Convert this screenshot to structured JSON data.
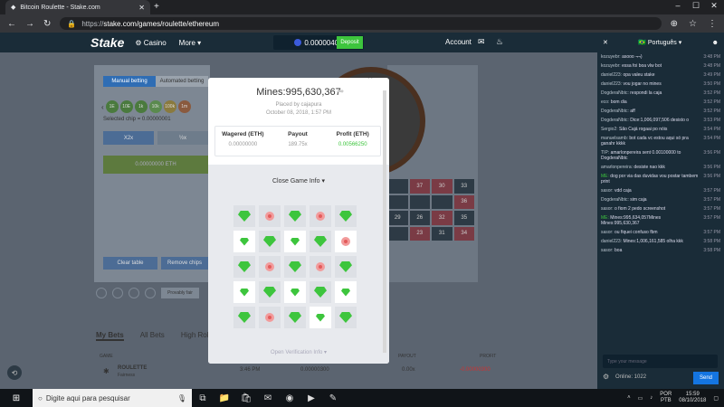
{
  "browser": {
    "tab_title": "Bitcoin Roulette - Stake.com",
    "url_prefix": "https://",
    "url": "stake.com/games/roulette/ethereum"
  },
  "header": {
    "logo": "Stake",
    "casino": "Casino",
    "more": "More",
    "balance": "0.00000400",
    "deposit": "Deposit",
    "account": "Account"
  },
  "game": {
    "manual": "Manual betting",
    "auto": "Automated betting",
    "chips": [
      "1E",
      "10E",
      "1k",
      "10k",
      "100k",
      "1m"
    ],
    "selected_chip": "Selected chip = 0.00000001",
    "x2": "X2x",
    "half": "½x",
    "bet_total": "0.00000000 ETH",
    "clear": "Clear table",
    "remove": "Remove chips",
    "provably": "Provably fair",
    "grid_numbers": [
      "",
      "37",
      "30",
      "33",
      "",
      "",
      "",
      "36",
      "29",
      "26",
      "32",
      "35",
      "",
      "23",
      "31",
      "34",
      "",
      "",
      "",
      ""
    ]
  },
  "bets": {
    "tabs": [
      "My Bets",
      "All Bets",
      "High Rollers"
    ],
    "head": {
      "game": "GAME",
      "payout": "PAYOUT",
      "profit": "PROFIT"
    },
    "row": {
      "name": "ROULETTE",
      "sub": "Fairness",
      "time": "3:46 PM",
      "amount": "0.00000300",
      "payout": "0.00x",
      "profit": "-0.00000300"
    }
  },
  "modal": {
    "title": "Mines:995,630,367",
    "placed_by": "Placed by",
    "user": "cajapura",
    "date": "October 08, 2018, 1:57 PM",
    "stats": [
      {
        "label": "Wagered (ETH)",
        "value": "0.00000000"
      },
      {
        "label": "Payout",
        "value": "189.75x"
      },
      {
        "label": "Profit (ETH)",
        "value": "0.00566250"
      }
    ],
    "close_info": "Close Game Info",
    "open_verification": "Open Verification Info",
    "tiles": [
      "gem",
      "mine",
      "gem",
      "mine",
      "gem",
      "gem-rev",
      "gem",
      "gem-rev",
      "gem",
      "mine-rev",
      "gem",
      "mine",
      "gem",
      "mine",
      "gem",
      "gem-rev",
      "gem",
      "gem-rev",
      "gem",
      "gem-rev",
      "gem",
      "mine",
      "gem",
      "gem-rev",
      "gem"
    ]
  },
  "chat": {
    "language": "Português",
    "messages": [
      {
        "user": "kozuyebr:",
        "text": "asooo ¬¬)",
        "time": "3:48 PM"
      },
      {
        "user": "kozuyebr:",
        "text": "essa foi boa vlw bot",
        "time": "3:48 PM"
      },
      {
        "user": "daniel223:",
        "text": "opa valeu stake",
        "time": "3:49 PM"
      },
      {
        "user": "daniel223:",
        "text": "vou jogar no mines",
        "time": "3:50 PM"
      },
      {
        "user": "DogderaNbtc:",
        "text": "respondi la caja",
        "time": "3:52 PM"
      },
      {
        "user": "eco:",
        "text": "bom dia",
        "time": "3:52 PM"
      },
      {
        "user": "DogderaNbtc:",
        "text": "aff",
        "time": "3:52 PM"
      },
      {
        "user": "DogderaNbtc:",
        "text": "Dice:1,006,097,506 desisto o",
        "time": "3:53 PM"
      },
      {
        "user": "Sergio2:",
        "text": "São Cajá rogaai po nóis",
        "time": "3:54 PM"
      },
      {
        "user": "manuelsamb:",
        "text": "bot cada vc estou aqui só pra ganahr kkkk",
        "time": "3:54 PM"
      },
      {
        "user": "TIP:",
        "text": "amarlonpereira sent 0.00100000 to DogderaNbtc",
        "time": "3:56 PM"
      },
      {
        "user": "amarlonpereira:",
        "text": "desiste nao kkk",
        "time": "3:56 PM"
      },
      {
        "user": "ME:",
        "text": "dog por via das duvidas vou postar tambem print",
        "time": "3:56 PM"
      },
      {
        "user": "sasor:",
        "text": "vdd caja",
        "time": "3:57 PM"
      },
      {
        "user": "DogderaNbtc:",
        "text": "sim caja",
        "time": "3:57 PM"
      },
      {
        "user": "sasor:",
        "text": "o fiom 2 pedo screenshot",
        "time": "3:57 PM"
      },
      {
        "user": "ME:",
        "text": "Mines:995,634,057Mines Mines:995,630,367",
        "time": "3:57 PM"
      },
      {
        "user": "sasor:",
        "text": "ou fiquei confuso fbm",
        "time": "3:57 PM"
      },
      {
        "user": "daniel223:",
        "text": "Mines:1,006,161,585 olha kkk",
        "time": "3:58 PM"
      },
      {
        "user": "sasor:",
        "text": "boa",
        "time": "3:58 PM"
      }
    ],
    "input_placeholder": "Type your message",
    "online": "Online: 1022",
    "send": "Send"
  },
  "taskbar": {
    "search": "Digite aqui para pesquisar",
    "lang1": "POR",
    "lang2": "PTB",
    "time": "15:59",
    "date": "08/10/2018"
  }
}
